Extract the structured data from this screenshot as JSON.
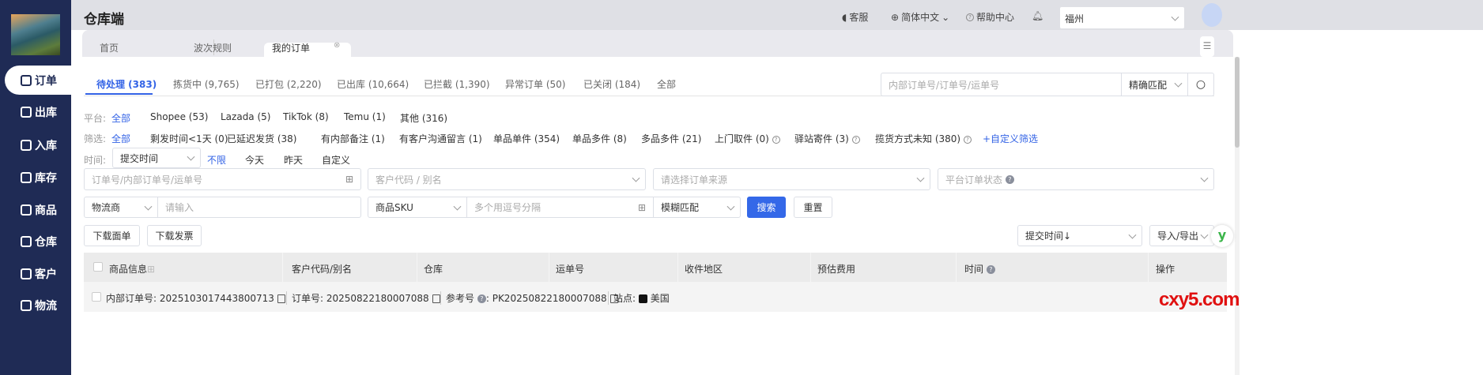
{
  "app": {
    "title": "仓库端"
  },
  "sidebar": {
    "items": [
      {
        "label": "订单"
      },
      {
        "label": "出库"
      },
      {
        "label": "入库"
      },
      {
        "label": "库存"
      },
      {
        "label": "商品"
      },
      {
        "label": "仓库"
      },
      {
        "label": "客户"
      },
      {
        "label": "物流"
      }
    ]
  },
  "header": {
    "service": "客服",
    "language": "简体中文",
    "help": "帮助中心",
    "city": "福州"
  },
  "page_tabs": [
    {
      "label": "首页"
    },
    {
      "label": "波次规则"
    },
    {
      "label": "我的订单"
    }
  ],
  "status_tabs": [
    {
      "label": "待处理 (383)"
    },
    {
      "label": "拣货中 (9,765)"
    },
    {
      "label": "已打包 (2,220)"
    },
    {
      "label": "已出库 (10,664)"
    },
    {
      "label": "已拦截 (1,390)"
    },
    {
      "label": "异常订单 (50)"
    },
    {
      "label": "已关闭 (184)"
    },
    {
      "label": "全部"
    }
  ],
  "quick_search": {
    "placeholder": "内部订单号/订单号/运单号",
    "match": "精确匹配"
  },
  "platform": {
    "label": "平台:",
    "items": [
      "全部",
      "Shopee (53)",
      "Lazada (5)",
      "TikTok (8)",
      "Temu (1)",
      "其他 (316)"
    ]
  },
  "filter": {
    "label": "筛选:",
    "items": [
      "全部",
      "剩发时间<1天 (0)",
      "已延迟发货 (38)",
      "有内部备注 (1)",
      "有客户沟通留言 (1)",
      "单品单件 (354)",
      "单品多件 (8)",
      "多品多件 (21)",
      "上门取件 (0)",
      "驿站寄件 (3)",
      "揽货方式未知 (380)"
    ],
    "custom": "+自定义筛选"
  },
  "time": {
    "label": "时间:",
    "select": "提交时间",
    "options": [
      "不限",
      "今天",
      "昨天",
      "自定义"
    ]
  },
  "form": {
    "order_no": "订单号/内部订单号/运单号",
    "customer": "客户代码 / 别名",
    "source": "请选择订单来源",
    "platform_status": "平台订单状态",
    "carrier": "物流商",
    "carrier_input": "请输入",
    "sku_select": "商品SKU",
    "sku_input": "多个用逗号分隔",
    "fuzzy": "模糊匹配",
    "search": "搜索",
    "reset": "重置"
  },
  "actions": {
    "download_label": "下载面单",
    "download_invoice": "下载发票",
    "sort": "提交时间↓",
    "import_export": "导入/导出"
  },
  "table": {
    "headers": [
      "商品信息",
      "客户代码/别名",
      "仓库",
      "运单号",
      "收件地区",
      "预估费用",
      "时间",
      "操作"
    ],
    "row": {
      "internal_label": "内部订单号:",
      "internal_no": "2025103017443800713",
      "order_label": "订单号:",
      "order_no": "20250822180007088",
      "ref_label": "参考号",
      "ref_no": ": PK20250822180007088",
      "site_label": "站点:",
      "site": "美国"
    }
  },
  "watermark": "cxy5.com"
}
